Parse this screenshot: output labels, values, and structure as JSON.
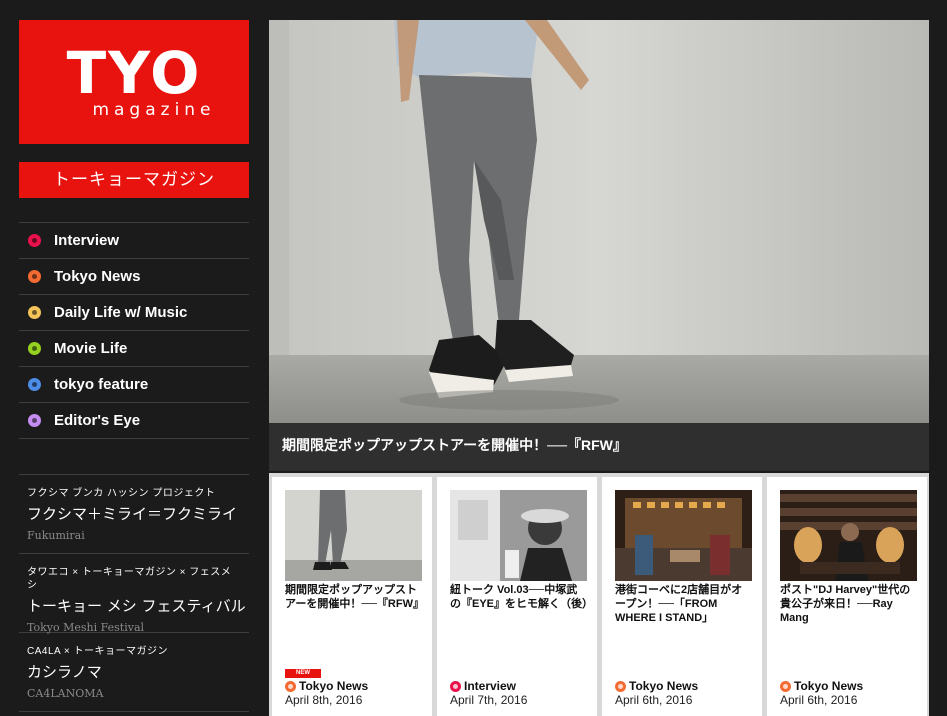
{
  "brand": {
    "logo_main": "TYO",
    "logo_sub": "magazine",
    "katakana": "トーキョーマガジン",
    "color": "#e8130f"
  },
  "nav": [
    {
      "label": "Interview",
      "color": "#e8114b"
    },
    {
      "label": "Tokyo News",
      "color": "#f36b32"
    },
    {
      "label": "Daily Life w/ Music",
      "color": "#f4c35a"
    },
    {
      "label": "Movie Life",
      "color": "#96d11f"
    },
    {
      "label": "tokyo feature",
      "color": "#4d8de8"
    },
    {
      "label": "Editor's Eye",
      "color": "#c58df0"
    }
  ],
  "projects": [
    {
      "sub": "フクシマ ブンカ ハッシン プロジェクト",
      "title": "フクシマ＋ミライ＝フクミライ",
      "roman": "Fukumirai"
    },
    {
      "sub": "タワエコ × トーキョーマガジン × フェスメシ",
      "title": "トーキョー メシ フェスティバル",
      "roman": "Tokyo Meshi Festival"
    },
    {
      "sub": "CA4LA × トーキョーマガジン",
      "title": "カシラノマ",
      "roman": "CA4LANOMA"
    }
  ],
  "hero": {
    "caption": "期間限定ポップアップストアーを開催中！──『RFW』"
  },
  "cards": [
    {
      "title": "期間限定ポップアップストアーを開催中！──『RFW』",
      "badge": "NEW",
      "category": "Tokyo News",
      "category_color": "#f36b32",
      "date": "April 8th, 2016"
    },
    {
      "title": "紐トーク Vol.03──中塚武の『EYE』をヒモ解く（後）",
      "badge": "",
      "category": "Interview",
      "category_color": "#e8114b",
      "date": "April 7th, 2016"
    },
    {
      "title": "港街コーベに2店舗目がオープン！──「FROM WHERE I STAND」",
      "badge": "",
      "category": "Tokyo News",
      "category_color": "#f36b32",
      "date": "April 6th, 2016"
    },
    {
      "title": "ポスト\"DJ Harvey\"世代の貴公子が来日！──Ray Mang",
      "badge": "",
      "category": "Tokyo News",
      "category_color": "#f36b32",
      "date": "April 6th, 2016"
    }
  ]
}
